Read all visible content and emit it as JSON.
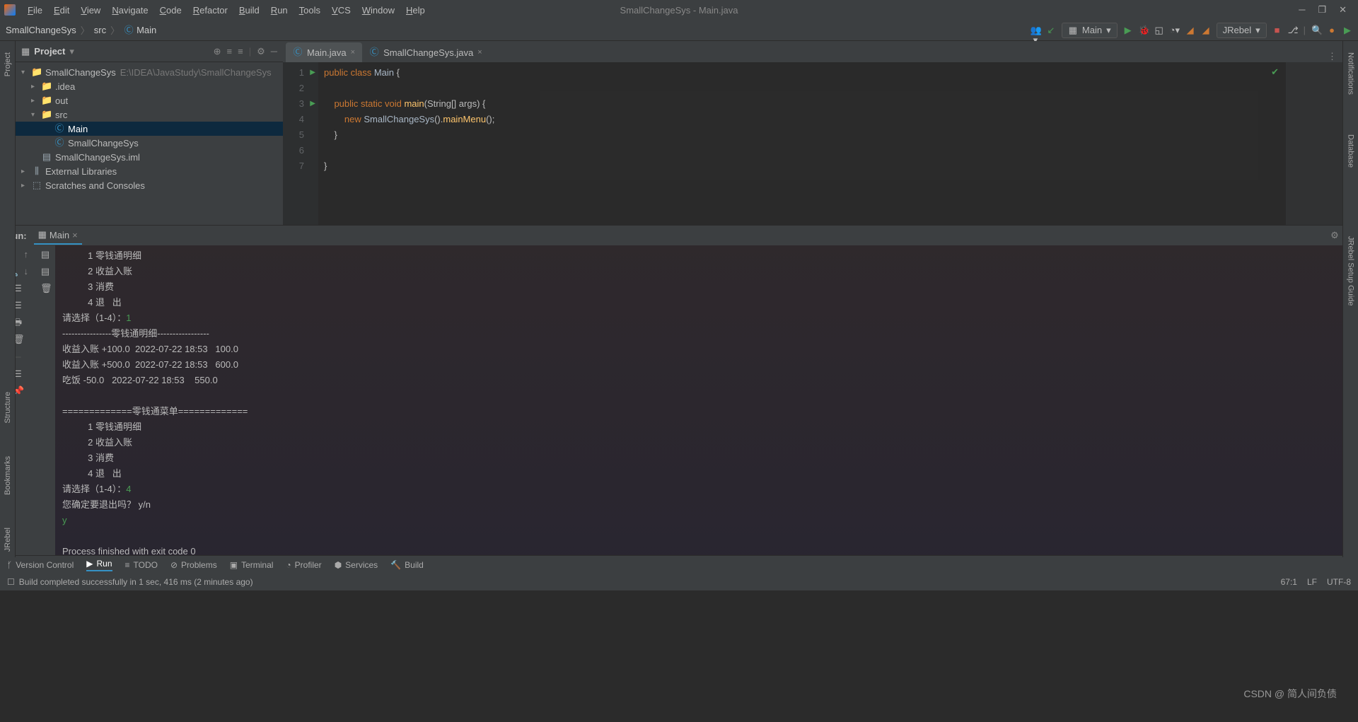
{
  "window": {
    "title": "SmallChangeSys - Main.java"
  },
  "menu": [
    "File",
    "Edit",
    "View",
    "Navigate",
    "Code",
    "Refactor",
    "Build",
    "Run",
    "Tools",
    "VCS",
    "Window",
    "Help"
  ],
  "breadcrumb": [
    {
      "label": "SmallChangeSys",
      "icon": "folder"
    },
    {
      "label": "src",
      "icon": "folder"
    },
    {
      "label": "Main",
      "icon": "class"
    }
  ],
  "runconfig": {
    "label": "Main"
  },
  "jrebel": {
    "label": "JRebel"
  },
  "project": {
    "title": "Project",
    "tree": [
      {
        "level": 0,
        "arrow": "▾",
        "icon": "folder",
        "label": "SmallChangeSys",
        "path": "E:\\IDEA\\JavaStudy\\SmallChangeSys",
        "sel": false
      },
      {
        "level": 1,
        "arrow": "▸",
        "icon": "folder-dim",
        "label": ".idea",
        "sel": false
      },
      {
        "level": 1,
        "arrow": "▸",
        "icon": "folder-orange",
        "label": "out",
        "sel": false
      },
      {
        "level": 1,
        "arrow": "▾",
        "icon": "folder-blue",
        "label": "src",
        "sel": false
      },
      {
        "level": 2,
        "arrow": "",
        "icon": "class",
        "label": "Main",
        "sel": true
      },
      {
        "level": 2,
        "arrow": "",
        "icon": "class",
        "label": "SmallChangeSys",
        "sel": false
      },
      {
        "level": 1,
        "arrow": "",
        "icon": "iml",
        "label": "SmallChangeSys.iml",
        "sel": false
      },
      {
        "level": 0,
        "arrow": "▸",
        "icon": "lib",
        "label": "External Libraries",
        "sel": false
      },
      {
        "level": 0,
        "arrow": "▸",
        "icon": "scratch",
        "label": "Scratches and Consoles",
        "sel": false
      }
    ]
  },
  "tabs": [
    {
      "label": "Main.java",
      "active": true
    },
    {
      "label": "SmallChangeSys.java",
      "active": false
    }
  ],
  "code": {
    "lines": [
      {
        "n": 1,
        "run": true,
        "html": "public class Main {",
        "tokens": [
          [
            "kw",
            "public "
          ],
          [
            "kw",
            "class "
          ],
          [
            "cls",
            "Main "
          ],
          [
            "",
            "{"
          ]
        ]
      },
      {
        "n": 2,
        "html": ""
      },
      {
        "n": 3,
        "run": true,
        "tokens": [
          [
            "",
            "    "
          ],
          [
            "kw",
            "public "
          ],
          [
            "kw",
            "static "
          ],
          [
            "kw",
            "void "
          ],
          [
            "mth",
            "main"
          ],
          [
            "",
            "(String[] args) {"
          ]
        ]
      },
      {
        "n": 4,
        "tokens": [
          [
            "",
            "        "
          ],
          [
            "kw",
            "new "
          ],
          [
            "cls",
            "SmallChangeSys"
          ],
          [
            "",
            "()."
          ],
          [
            "mth",
            "mainMenu"
          ],
          [
            "",
            "();"
          ]
        ]
      },
      {
        "n": 5,
        "tokens": [
          [
            "",
            "    }"
          ]
        ]
      },
      {
        "n": 6,
        "tokens": [
          [
            "",
            ""
          ]
        ]
      },
      {
        "n": 7,
        "tokens": [
          [
            "",
            "}"
          ]
        ]
      }
    ]
  },
  "lefttabs": [
    "Project",
    "Bookmarks",
    "Structure",
    "JRebel"
  ],
  "righttabs": [
    "Notifications",
    "Database",
    "JRebel Setup Guide"
  ],
  "run": {
    "title": "Run:",
    "tab": "Main",
    "console": [
      {
        "t": "          1 零钱通明细"
      },
      {
        "t": "          2 收益入账"
      },
      {
        "t": "          3 消费"
      },
      {
        "t": "          4 退   出"
      },
      {
        "pre": "请选择（1-4）：",
        "in": "1"
      },
      {
        "t": "----------------零钱通明细-----------------"
      },
      {
        "t": "收益入账 +100.0  2022-07-22 18:53   100.0"
      },
      {
        "t": "收益入账 +500.0  2022-07-22 18:53   600.0"
      },
      {
        "t": "吃饭 -50.0   2022-07-22 18:53    550.0"
      },
      {
        "t": ""
      },
      {
        "t": "=============零钱通菜单============="
      },
      {
        "t": "          1 零钱通明细"
      },
      {
        "t": "          2 收益入账"
      },
      {
        "t": "          3 消费"
      },
      {
        "t": "          4 退   出"
      },
      {
        "pre": "请选择（1-4）：",
        "in": "4"
      },
      {
        "t": "您确定要退出吗？ y/n"
      },
      {
        "in": "y"
      },
      {
        "t": ""
      },
      {
        "t": "Process finished with exit code 0"
      }
    ]
  },
  "bottomtabs": [
    {
      "icon": "branch",
      "label": "Version Control"
    },
    {
      "icon": "play",
      "label": "Run",
      "active": true
    },
    {
      "icon": "todo",
      "label": "TODO"
    },
    {
      "icon": "problems",
      "label": "Problems"
    },
    {
      "icon": "terminal",
      "label": "Terminal"
    },
    {
      "icon": "profiler",
      "label": "Profiler"
    },
    {
      "icon": "services",
      "label": "Services"
    },
    {
      "icon": "build",
      "label": "Build"
    }
  ],
  "status": {
    "msg": "Build completed successfully in 1 sec, 416 ms (2 minutes ago)",
    "right": [
      "67:1",
      "LF",
      "UTF-8"
    ]
  },
  "watermark": "CSDN @ 简人间负债"
}
